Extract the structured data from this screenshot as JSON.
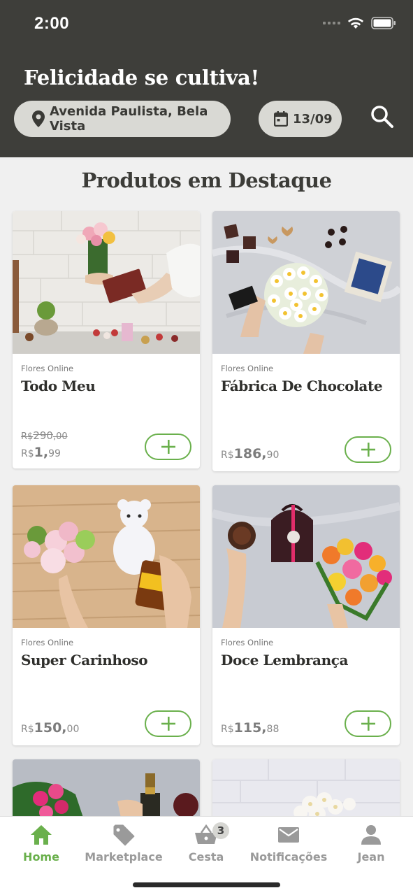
{
  "status_bar": {
    "time": "2:00"
  },
  "header": {
    "tagline": "Felicidade se cultiva!",
    "location": "Avenida Paulista, Bela Vista",
    "date": "13/09",
    "icons": {
      "location": "location-pin-icon",
      "date": "calendar-icon",
      "search": "search-icon"
    }
  },
  "section_title": "Produtos em Destaque",
  "products": [
    {
      "brand": "Flores Online",
      "name": "Todo Meu",
      "old_price": {
        "currency": "R$",
        "int": "290",
        "dec": ",00"
      },
      "price": {
        "currency": "R$",
        "int": "1,",
        "dec": "99"
      }
    },
    {
      "brand": "Flores Online",
      "name": "Fábrica De Chocolate",
      "price": {
        "currency": "R$",
        "int": "186,",
        "dec": "90"
      }
    },
    {
      "brand": "Flores Online",
      "name": "Super Carinhoso",
      "price": {
        "currency": "R$",
        "int": "150,",
        "dec": "00"
      }
    },
    {
      "brand": "Flores Online",
      "name": "Doce Lembrança",
      "price": {
        "currency": "R$",
        "int": "115,",
        "dec": "88"
      }
    }
  ],
  "bottom_nav": [
    {
      "label": "Home",
      "icon": "home-icon",
      "active": true
    },
    {
      "label": "Marketplace",
      "icon": "tag-icon"
    },
    {
      "label": "Cesta",
      "icon": "basket-icon",
      "badge": "3"
    },
    {
      "label": "Notificações",
      "icon": "mail-icon"
    },
    {
      "label": "Jean",
      "icon": "user-icon"
    }
  ],
  "colors": {
    "header_bg": "#3e3e3a",
    "accent": "#6ab04c",
    "pill_bg": "#d9d9d4"
  }
}
